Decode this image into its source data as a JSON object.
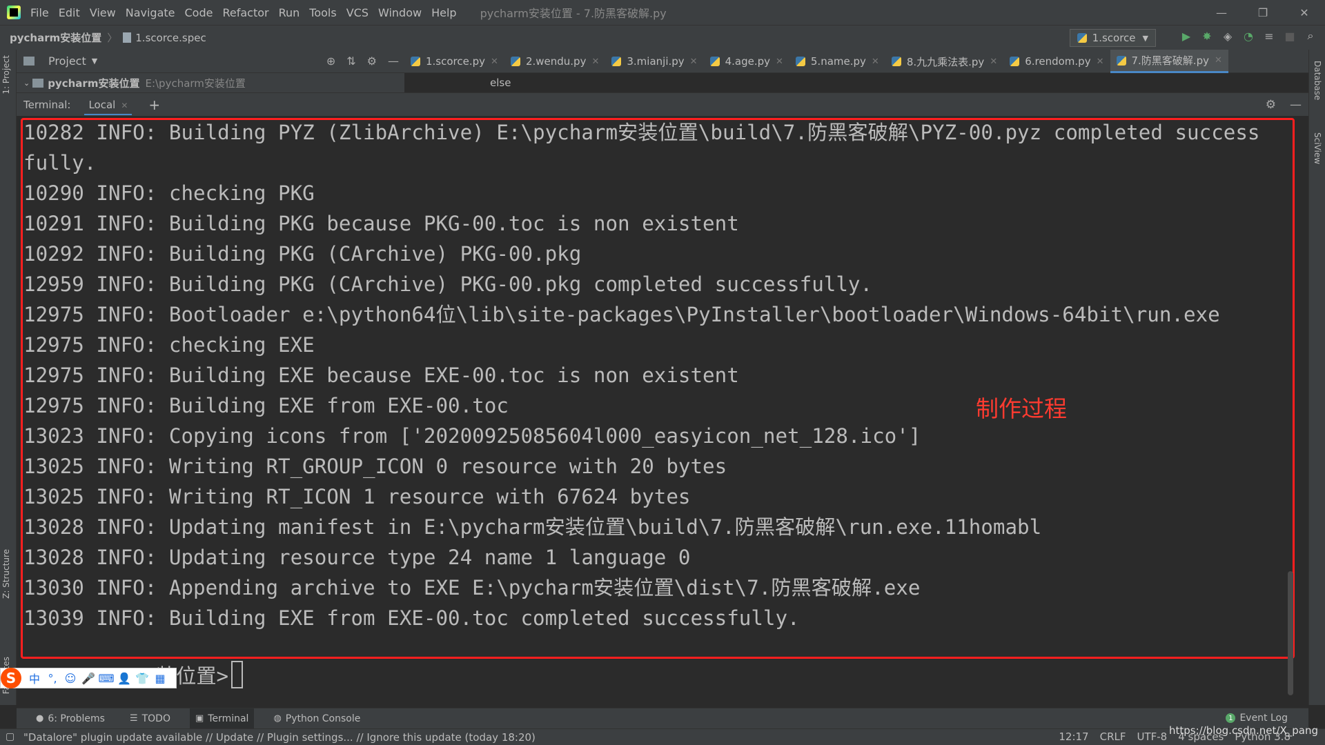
{
  "menubar": {
    "items": [
      "File",
      "Edit",
      "View",
      "Navigate",
      "Code",
      "Refactor",
      "Run",
      "Tools",
      "VCS",
      "Window",
      "Help"
    ],
    "window_title": "pycharm安装位置 - 7.防黑客破解.py"
  },
  "navbar": {
    "project": "pycharm安装位置",
    "file": "1.scorce.spec",
    "run_config": "1.scorce"
  },
  "project_panel": {
    "title": "Project",
    "root_name": "pycharm安装位置",
    "root_path": "E:\\pycharm安装位置"
  },
  "editor": {
    "tabs": [
      "1.scorce.py",
      "2.wendu.py",
      "3.mianji.py",
      "4.age.py",
      "5.name.py",
      "8.九九乘法表.py",
      "6.rendom.py",
      "7.防黑客破解.py"
    ],
    "visible_text": "else"
  },
  "side_tabs": {
    "left": [
      "1: Project",
      "Z: Structure",
      "Favorites"
    ],
    "right": [
      "Database",
      "SciView"
    ]
  },
  "terminal": {
    "label": "Terminal:",
    "tab": "Local",
    "lines": [
      "10282 INFO: Building PYZ (ZlibArchive) E:\\pycharm安装位置\\build\\7.防黑客破解\\PYZ-00.pyz completed success",
      "fully.",
      "10290 INFO: checking PKG",
      "10291 INFO: Building PKG because PKG-00.toc is non existent",
      "10292 INFO: Building PKG (CArchive) PKG-00.pkg",
      "12959 INFO: Building PKG (CArchive) PKG-00.pkg completed successfully.",
      "12975 INFO: Bootloader e:\\python64位\\lib\\site-packages\\PyInstaller\\bootloader\\Windows-64bit\\run.exe",
      "12975 INFO: checking EXE",
      "12975 INFO: Building EXE because EXE-00.toc is non existent",
      "12975 INFO: Building EXE from EXE-00.toc",
      "13023 INFO: Copying icons from ['20200925085604l000_easyicon_net_128.ico']",
      "13025 INFO: Writing RT_GROUP_ICON 0 resource with 20 bytes",
      "13025 INFO: Writing RT_ICON 1 resource with 67624 bytes",
      "13028 INFO: Updating manifest in E:\\pycharm安装位置\\build\\7.防黑客破解\\run.exe.11homabl",
      "13028 INFO: Updating resource type 24 name 1 language 0",
      "13030 INFO: Appending archive to EXE E:\\pycharm安装位置\\dist\\7.防黑客破解.exe",
      "13039 INFO: Building EXE from EXE-00.toc completed successfully."
    ],
    "annotation": "制作过程",
    "prompt": "装位置>"
  },
  "ime": {
    "mode": "中",
    "punct": "°,"
  },
  "bottom_tools": {
    "problems": "6: Problems",
    "todo": "TODO",
    "terminal": "Terminal",
    "python_console": "Python Console",
    "event_log": "Event Log",
    "event_count": "1"
  },
  "status": {
    "message": "\"Datalore\" plugin update available // Update // Plugin settings... // Ignore this update (today 18:20)",
    "position": "12:17",
    "line_sep": "CRLF",
    "encoding": "UTF-8",
    "indent": "4 spaces",
    "interpreter": "Python 3.8",
    "watermark": "https://blog.csdn.net/X_pang"
  },
  "colors": {
    "highlight": "#ff1f1f",
    "annotation": "#ff3b30",
    "accent": "#4a88c7"
  }
}
